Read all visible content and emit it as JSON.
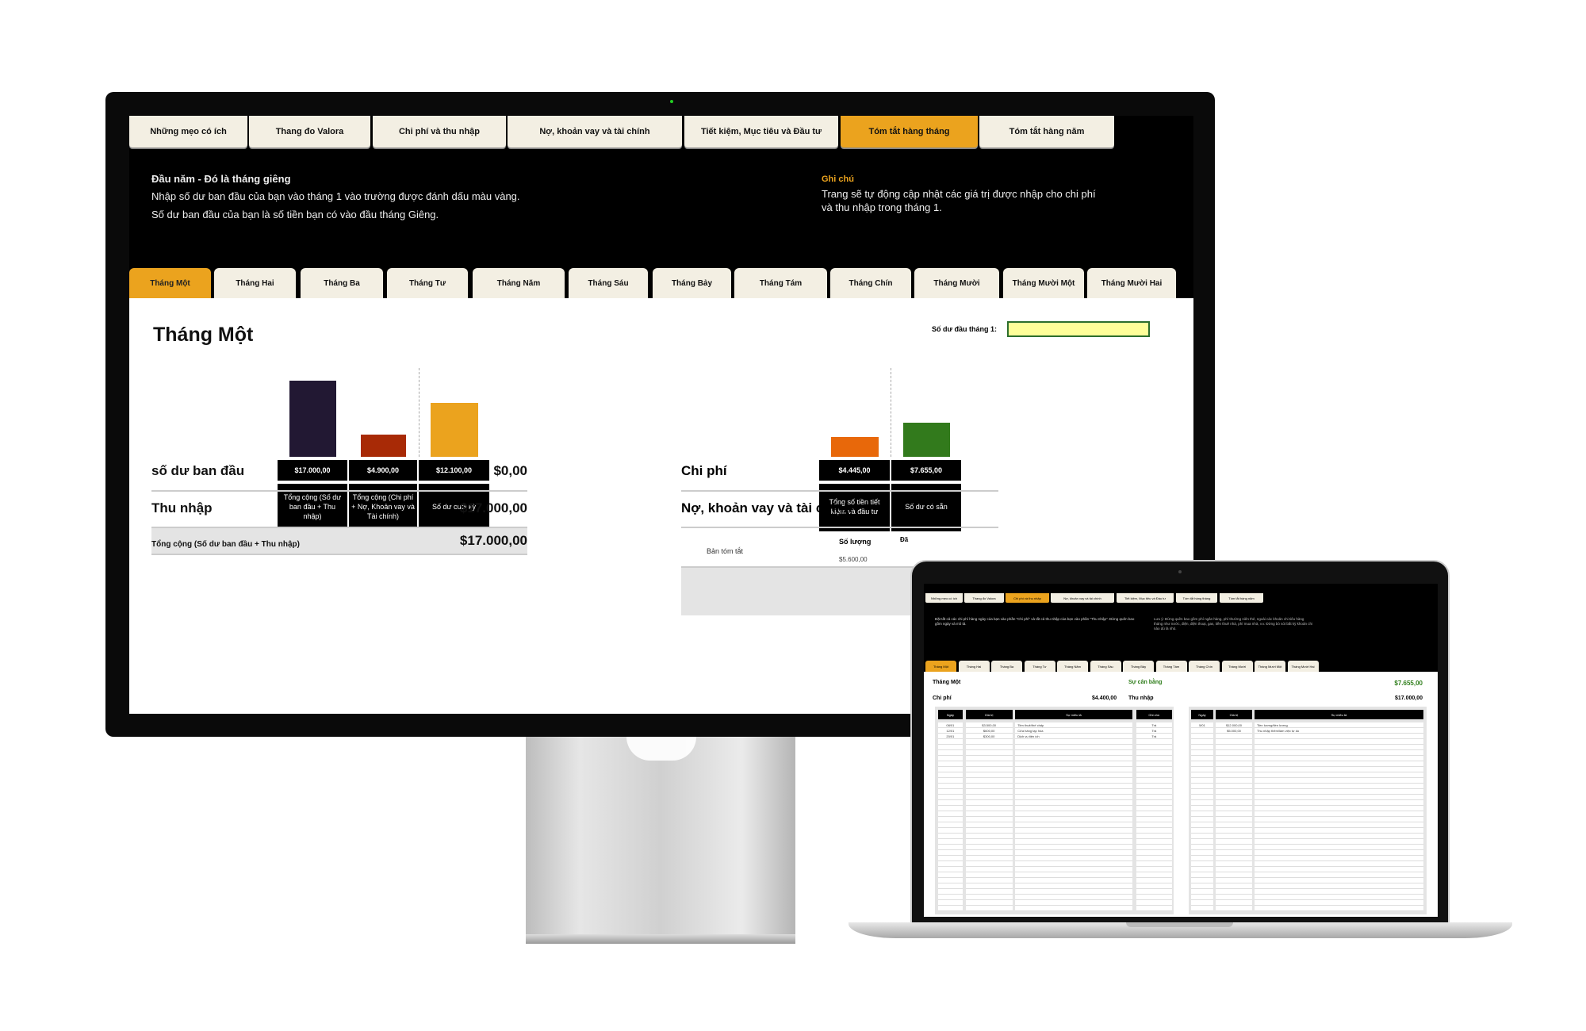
{
  "monitor": {
    "top_tabs": [
      {
        "label": "Những mẹo có ích"
      },
      {
        "label": "Thang đo Valora"
      },
      {
        "label": "Chi phí và thu nhập"
      },
      {
        "label": "Nợ, khoản vay và tài chính"
      },
      {
        "label": "Tiết kiệm, Mục tiêu và Đầu tư"
      },
      {
        "label": "Tóm tắt hàng tháng",
        "active": true
      },
      {
        "label": "Tóm tắt hàng năm"
      }
    ],
    "intro": {
      "title": "Đầu năm - Đó là tháng giêng",
      "line1": "Nhập số dư ban đầu của bạn vào tháng 1 vào trường được đánh dấu màu vàng.",
      "line2": "Số dư ban đầu của bạn là số tiền bạn có vào đầu tháng Giêng."
    },
    "note": {
      "title": "Ghi chú",
      "text": "Trang sẽ tự động cập nhật các giá trị được nhập cho chi phí và thu nhập trong tháng 1."
    },
    "month_tabs": [
      {
        "label": "Tháng Một",
        "active": true
      },
      {
        "label": "Tháng Hai"
      },
      {
        "label": "Tháng Ba"
      },
      {
        "label": "Tháng Tư"
      },
      {
        "label": "Tháng Năm"
      },
      {
        "label": "Tháng Sáu"
      },
      {
        "label": "Tháng Bảy"
      },
      {
        "label": "Tháng Tám"
      },
      {
        "label": "Tháng Chín"
      },
      {
        "label": "Tháng Mười"
      },
      {
        "label": "Tháng Mười Một"
      },
      {
        "label": "Tháng Mười Hai"
      }
    ],
    "page_title": "Tháng Một",
    "opening_label": "Số dư đầu tháng 1:",
    "opening_value": "",
    "chart_data": [
      {
        "type": "bar",
        "categories": [
          "Tổng cộng (Số dư ban đầu + Thu nhập)",
          "Tổng cộng (Chi phí + Nợ, Khoản vay và Tài chính)",
          "Số dư cuối kỳ"
        ],
        "values": [
          17000,
          4900,
          12100
        ],
        "labels": [
          "$17.000,00",
          "$4.900,00",
          "$12.100,00"
        ],
        "colors": [
          "#221833",
          "#a82a06",
          "#eba31e"
        ]
      },
      {
        "type": "bar",
        "categories": [
          "Tổng số tiền tiết kiệm và đầu tư",
          "Số dư có sẵn"
        ],
        "values": [
          4445,
          7655
        ],
        "labels": [
          "$4.445,00",
          "$7.655,00"
        ],
        "colors": [
          "#e8680a",
          "#327a1c"
        ]
      }
    ],
    "summary": {
      "opening_label": "số dư ban đầu",
      "opening": "$0,00",
      "income_label": "Thu nhập",
      "income": "$17.000,00",
      "total_label": "Tổng cộng (Số dư ban đầu + Thu nhập)",
      "total": "$17.000,00"
    },
    "right": {
      "expenses_label": "Chi phí",
      "debt_label": "Nợ, khoản vay và tài chính",
      "summary_label": "Bản tóm tắt",
      "qty_label": "Số lượng",
      "qty_value": "$5.600,00",
      "cut_label": "Đã"
    }
  },
  "laptop": {
    "top_tabs": [
      {
        "label": "Những mẹo có ích"
      },
      {
        "label": "Thang đo Valora"
      },
      {
        "label": "Chi phí và thu nhập",
        "active": true
      },
      {
        "label": "Nợ, khoản vay và tài chính"
      },
      {
        "label": "Tiết kiệm, Mục tiêu và Đầu tư"
      },
      {
        "label": "Tóm tắt hàng tháng"
      },
      {
        "label": "Tóm tắt hàng năm"
      }
    ],
    "intro": "Đặt tất cả các chi phí hàng ngày của bạn vào phần \"Chi phí\" và tất cả thu nhập của bạn vào phần \"Thu nhập\". Đừng quên bao gồm ngày và mô tả.",
    "note": "Lưu ý: Đừng quên bao gồm phí ngân hàng, phí thường niên thẻ, ngoài các khoản chi tiêu hàng tháng như nước, điện, điện thoại, gas, tiền thuê nhà, phí mua nhà, v.v. Đừng bỏ sót bất kỳ khoản chi nào dù là nhỏ.",
    "month_tabs": [
      {
        "label": "Tháng Một",
        "active": true
      },
      {
        "label": "Tháng Hai"
      },
      {
        "label": "Tháng Ba"
      },
      {
        "label": "Tháng Tư"
      },
      {
        "label": "Tháng Năm"
      },
      {
        "label": "Tháng Sáu"
      },
      {
        "label": "Tháng Bảy"
      },
      {
        "label": "Tháng Tám"
      },
      {
        "label": "Tháng Chín"
      },
      {
        "label": "Tháng Mười"
      },
      {
        "label": "Tháng Mười Một"
      },
      {
        "label": "Tháng Mười Hai"
      }
    ],
    "title": "Tháng Một",
    "balance_label": "Sự cân bằng",
    "balance": "$7.655,00",
    "balance_color": "#2e7d1a",
    "expenses": {
      "label": "Chi phí",
      "total": "$4.400,00",
      "headers": [
        "Ngày",
        "Giá trị",
        "Sự miêu tả",
        "Ghi chú"
      ],
      "rows": [
        [
          "08/01",
          "$3.500,00",
          "Tiền thuê/thế chấp",
          "Trả"
        ],
        [
          "12/01",
          "$600,00",
          "Cửa hàng tạp hóa",
          "Trả"
        ],
        [
          "20/01",
          "$300,00",
          "Dịch vụ tiện ích",
          "Trả"
        ]
      ]
    },
    "income": {
      "label": "Thu nhập",
      "total": "$17.000,00",
      "headers": [
        "Ngày",
        "Giá trị",
        "Sự miêu tả"
      ],
      "rows": [
        [
          "5/01",
          "$12.000,00",
          "Tiền lương/tiền lương"
        ],
        [
          "",
          "$5.000,00",
          "Thu nhập thêm/làm việc tự do"
        ]
      ]
    }
  }
}
